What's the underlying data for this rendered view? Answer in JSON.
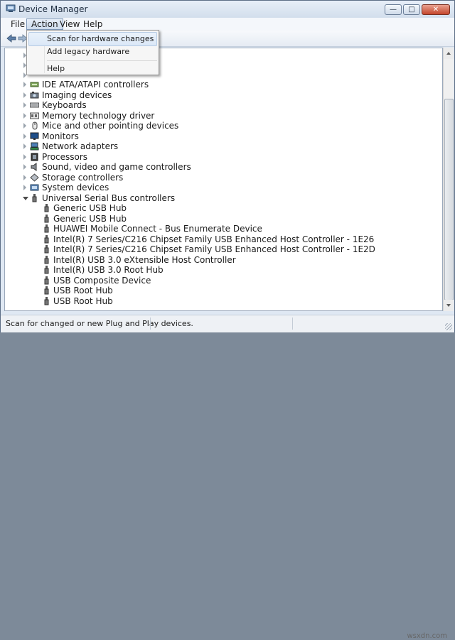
{
  "window": {
    "title": "Device Manager"
  },
  "window_buttons": {
    "minimize": "—",
    "maximize": "□",
    "close": "✕"
  },
  "menubar": {
    "items": [
      "File",
      "Action",
      "View",
      "Help"
    ],
    "active": "Action"
  },
  "action_menu": {
    "items": [
      "Scan for hardware changes",
      "Add legacy hardware",
      "Help"
    ]
  },
  "tree": {
    "categories": [
      {
        "label": "IDE ATA/ATAPI controllers",
        "icon": "ide-controller-icon"
      },
      {
        "label": "Imaging devices",
        "icon": "camera-icon"
      },
      {
        "label": "Keyboards",
        "icon": "keyboard-icon"
      },
      {
        "label": "Memory technology driver",
        "icon": "memory-icon"
      },
      {
        "label": "Mice and other pointing devices",
        "icon": "mouse-icon"
      },
      {
        "label": "Monitors",
        "icon": "monitor-icon"
      },
      {
        "label": "Network adapters",
        "icon": "network-icon"
      },
      {
        "label": "Processors",
        "icon": "processor-icon"
      },
      {
        "label": "Sound, video and game controllers",
        "icon": "speaker-icon"
      },
      {
        "label": "Storage controllers",
        "icon": "storage-icon"
      },
      {
        "label": "System devices",
        "icon": "system-icon"
      },
      {
        "label": "Universal Serial Bus controllers",
        "icon": "usb-icon"
      }
    ],
    "usb_children": [
      "Generic USB Hub",
      "Generic USB Hub",
      "HUAWEI Mobile Connect - Bus Enumerate Device",
      "Intel(R) 7 Series/C216 Chipset Family USB Enhanced Host Controller - 1E26",
      "Intel(R) 7 Series/C216 Chipset Family USB Enhanced Host Controller - 1E2D",
      "Intel(R) USB 3.0 eXtensible Host Controller",
      "Intel(R) USB 3.0 Root Hub",
      "USB Composite Device",
      "USB Root Hub",
      "USB Root Hub"
    ]
  },
  "status": {
    "text": "Scan for changed or new Plug and Play devices."
  },
  "watermark": "wsxdn.com"
}
